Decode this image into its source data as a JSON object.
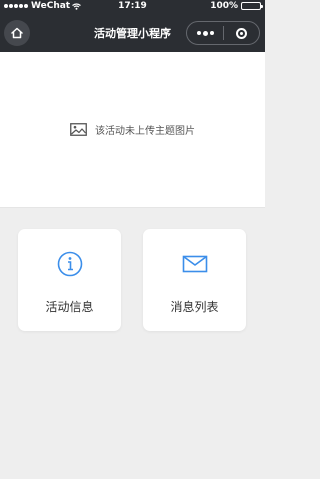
{
  "status_bar": {
    "carrier": "WeChat",
    "time": "17:19",
    "battery_text": "100%",
    "battery_level": 1.0
  },
  "nav_bar": {
    "title": "活动管理小程序",
    "home_icon": "home-icon",
    "more_icon": "more-icon",
    "close_icon": "close-icon"
  },
  "banner": {
    "text": "该活动未上传主题图片",
    "icon": "image-icon"
  },
  "cards": [
    {
      "label": "活动信息",
      "icon": "info-icon"
    },
    {
      "label": "消息列表",
      "icon": "mail-icon"
    }
  ],
  "colors": {
    "nav_background": "#2b2e33",
    "accent": "#3b8eea",
    "page_background": "#eeeeee"
  }
}
